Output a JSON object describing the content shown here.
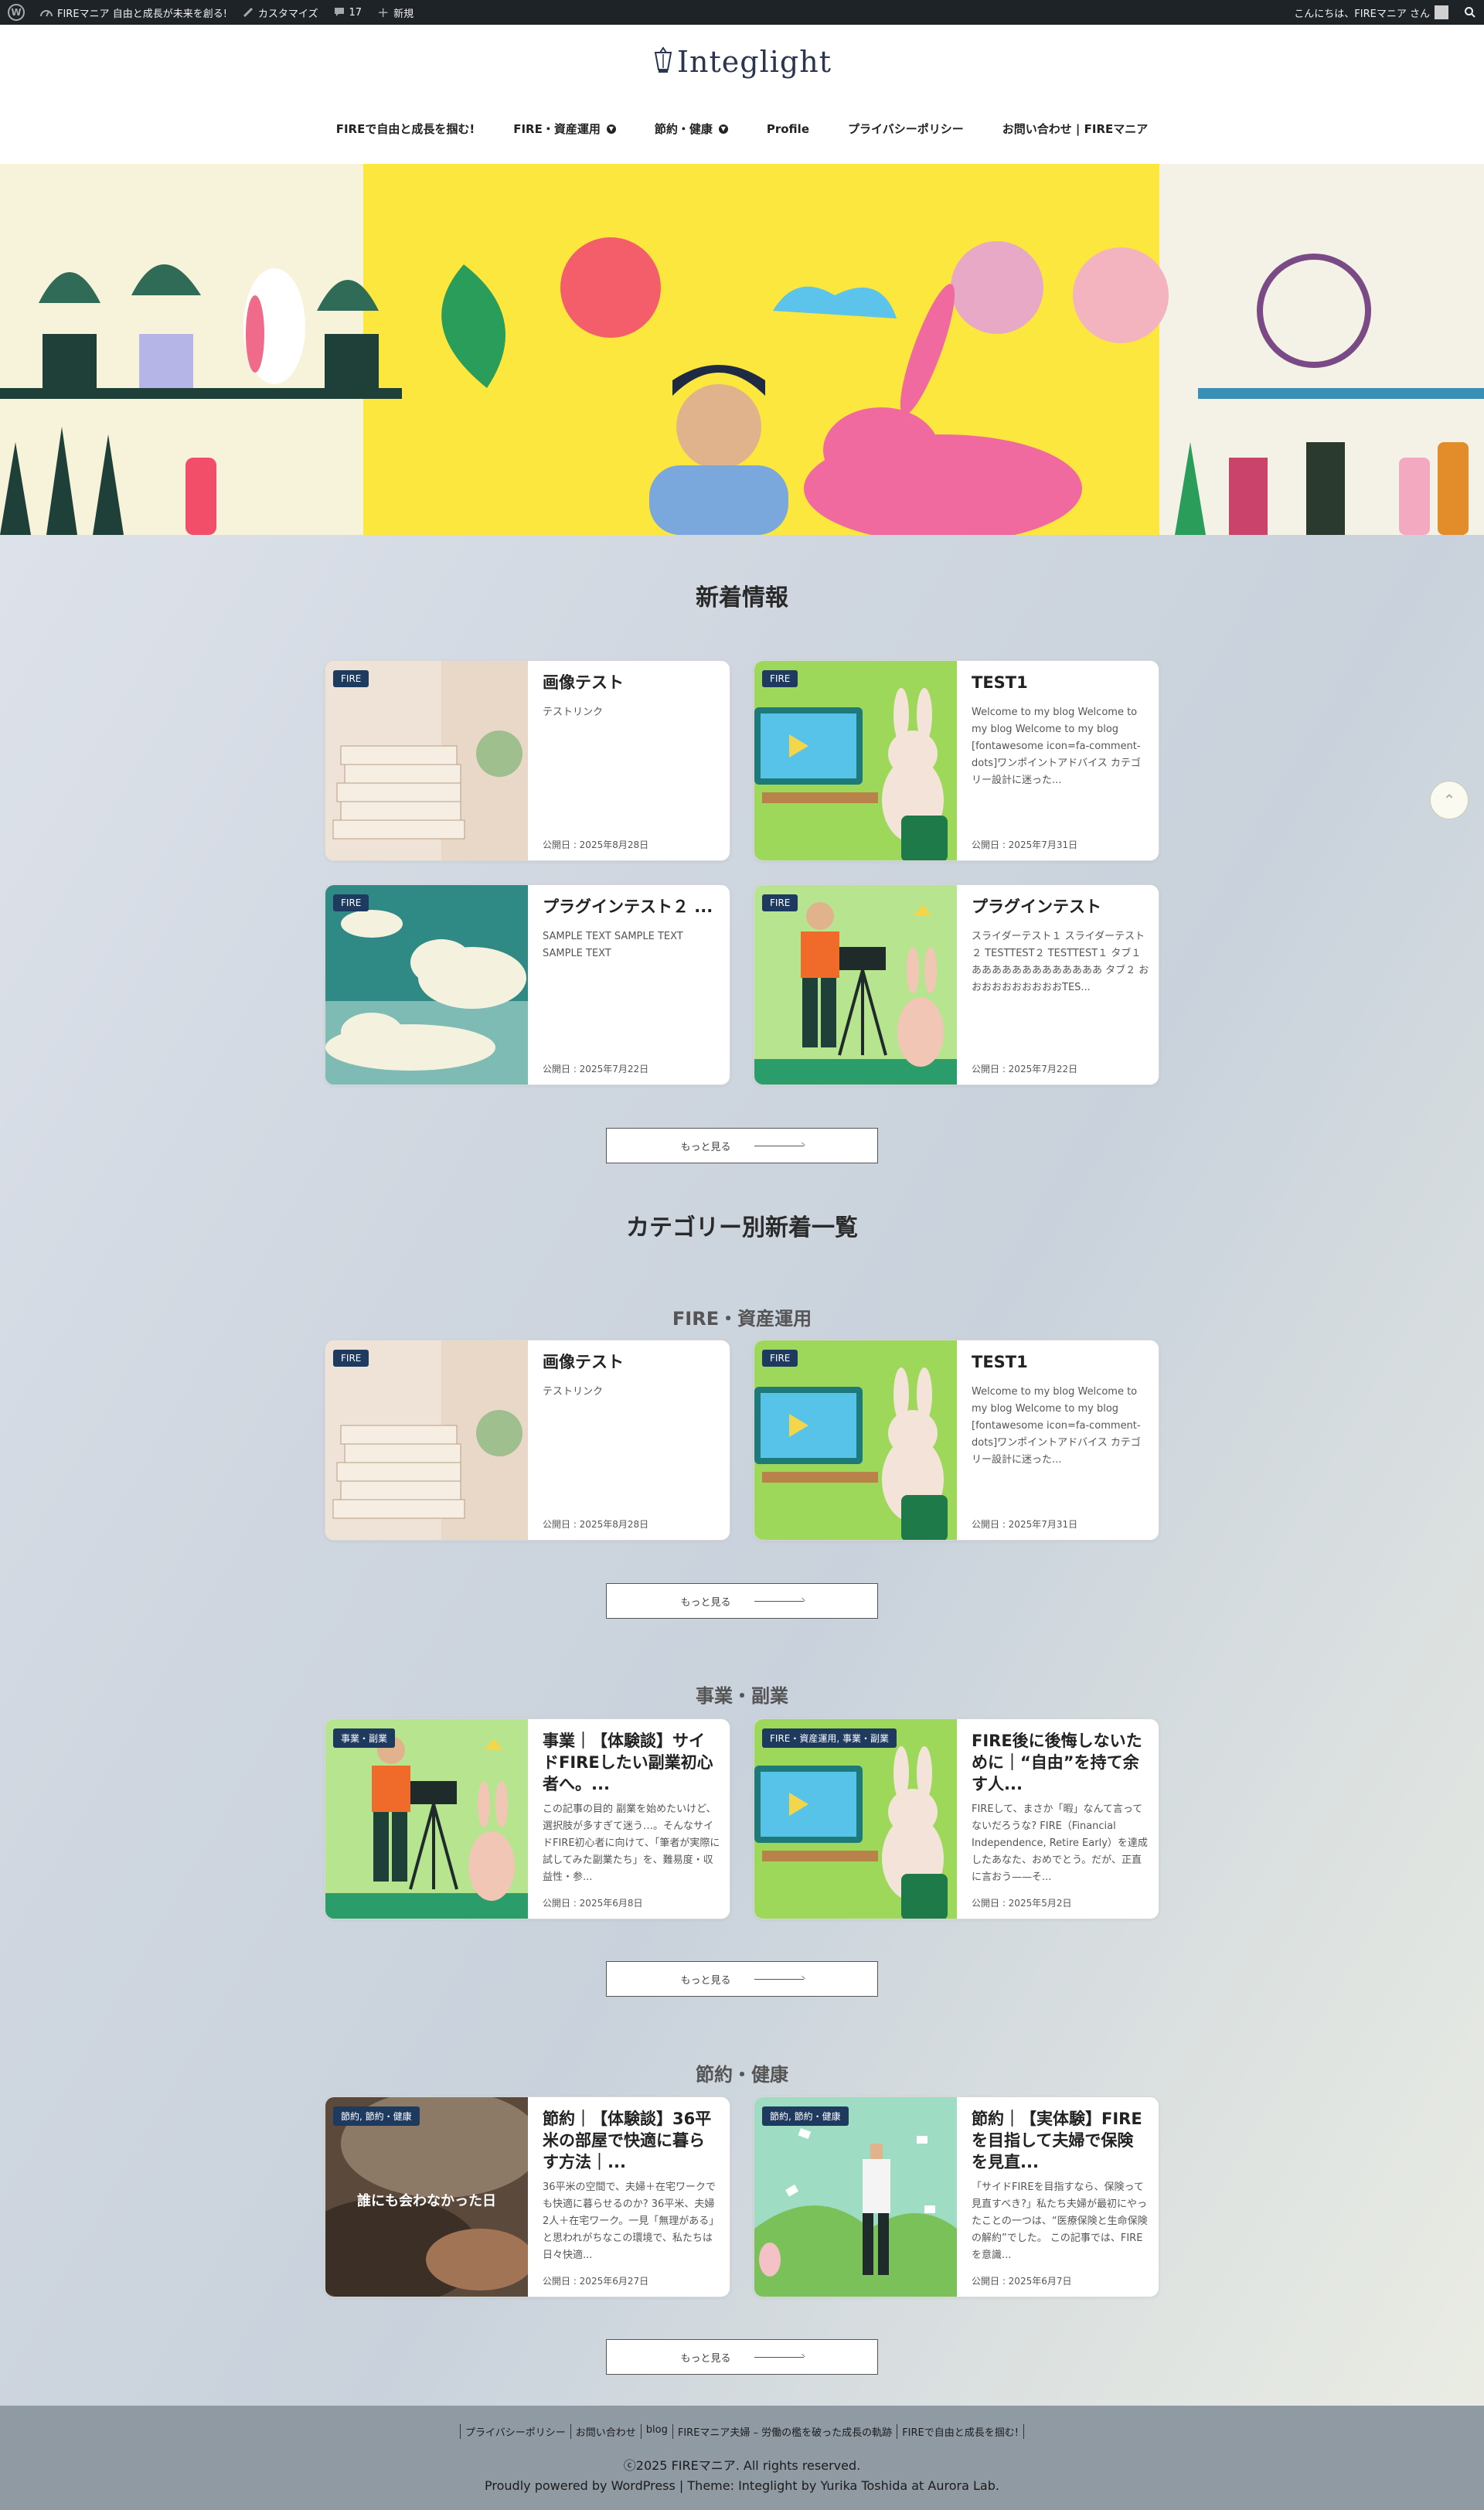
{
  "adminbar": {
    "site_name": "FIREマニア 自由と成長が未来を創る!",
    "customize": "カスタマイズ",
    "comments_count": "17",
    "new_label": "新規",
    "greeting": "こんにちは、FIREマニア さん"
  },
  "header": {
    "logo_text": "Integlight",
    "nav": [
      "FIREで自由と成長を掴む!",
      "FIRE・資産運用",
      "節約・健康",
      "Profile",
      "プライバシーポリシー",
      "お問い合わせ | FIREマニア"
    ]
  },
  "latest": {
    "title": "新着情報",
    "cards": [
      {
        "badge": "FIRE",
        "title": "画像テスト",
        "excerpt": "テストリンク",
        "date": "公開日 : 2025年8月28日"
      },
      {
        "badge": "FIRE",
        "title": "TEST1",
        "excerpt": "Welcome to my blog Welcome to my blog Welcome to my blog [fontawesome icon=fa-comment-dots]ワンポイントアドバイス カテゴリー設計に迷った...",
        "date": "公開日 : 2025年7月31日"
      },
      {
        "badge": "FIRE",
        "title": "プラグインテスト２ ...",
        "excerpt": "SAMPLE TEXT SAMPLE TEXT SAMPLE TEXT",
        "date": "公開日 : 2025年7月22日"
      },
      {
        "badge": "FIRE",
        "title": "プラグインテスト",
        "excerpt": "スライダーテスト１ スライダーテスト２ TESTTEST２ TESTTEST１ タブ１ あああああああああああああ タブ２ おおおおおおおおおおTES...",
        "date": "公開日 : 2025年7月22日"
      }
    ],
    "more": "もっと見る"
  },
  "category_section": {
    "title": "カテゴリー別新着一覧",
    "groups": [
      {
        "title": "FIRE・資産運用",
        "cards": [
          {
            "badge": "FIRE",
            "title": "画像テスト",
            "excerpt": "テストリンク",
            "date": "公開日 : 2025年8月28日"
          },
          {
            "badge": "FIRE",
            "title": "TEST1",
            "excerpt": "Welcome to my blog Welcome to my blog Welcome to my blog [fontawesome icon=fa-comment-dots]ワンポイントアドバイス カテゴリー設計に迷った...",
            "date": "公開日 : 2025年7月31日"
          }
        ],
        "more": "もっと見る"
      },
      {
        "title": "事業・副業",
        "cards": [
          {
            "badge": "事業・副業",
            "title": "事業｜【体験談】サイドFIREしたい副業初心者へ。...",
            "excerpt": "この記事の目的 副業を始めたいけど、選択肢が多すぎて迷う…。そんなサイドFIRE初心者に向けて、「筆者が実際に試してみた副業たち」を、難易度・収益性・参...",
            "date": "公開日 : 2025年6月8日"
          },
          {
            "badge": "FIRE・資産運用, 事業・副業",
            "title": "FIRE後に後悔しないために｜“自由”を持て余す人...",
            "excerpt": "FIREして、まさか「暇」なんて言ってないだろうな? FIRE（Financial Independence, Retire Early）を達成したあなた、おめでとう。だが、正直に言おう——そ...",
            "date": "公開日 : 2025年5月2日"
          }
        ],
        "more": "もっと見る"
      },
      {
        "title": "節約・健康",
        "cards": [
          {
            "badge": "節約, 節約・健康",
            "title": "節約｜【体験談】36平米の部屋で快適に暮らす方法｜...",
            "excerpt": "36平米の空間で、夫婦＋在宅ワークでも快適に暮らせるのか? 36平米、夫婦2人＋在宅ワーク。一見「無理がある」と思われがちなこの環境で、私たちは日々快適...",
            "date": "公開日 : 2025年6月27日",
            "thumb_text": "誰にも会わなかった日"
          },
          {
            "badge": "節約, 節約・健康",
            "title": "節約｜【実体験】FIREを目指して夫婦で保険を見直...",
            "excerpt": "「サイドFIREを目指すなら、保険って見直すべき?」私たち夫婦が最初にやったことの一つは、“医療保険と生命保険の解約”でした。 この記事では、FIREを意識...",
            "date": "公開日 : 2025年6月7日"
          }
        ],
        "more": "もっと見る"
      }
    ]
  },
  "footer": {
    "nav": [
      "プライバシーポリシー",
      "お問い合わせ",
      "blog",
      "FIREマニア夫婦 – 労働の檻を破った成長の軌跡",
      "FIREで自由と成長を掴む!"
    ],
    "copyright": "ⓒ2025 FIREマニア. All rights reserved.",
    "powered": "Proudly powered by WordPress | Theme: Integlight by Yurika Toshida at Aurora Lab."
  },
  "icons": {
    "wordpress": "wordpress-icon",
    "customize": "paintbrush-icon",
    "comments": "comment-icon",
    "new": "plus-icon",
    "search": "search-icon",
    "totop": "chevron-up-icon"
  },
  "colors": {
    "badge": "#1e3a5f",
    "adminbar": "#1d2327",
    "footer": "#8f9aa3"
  }
}
